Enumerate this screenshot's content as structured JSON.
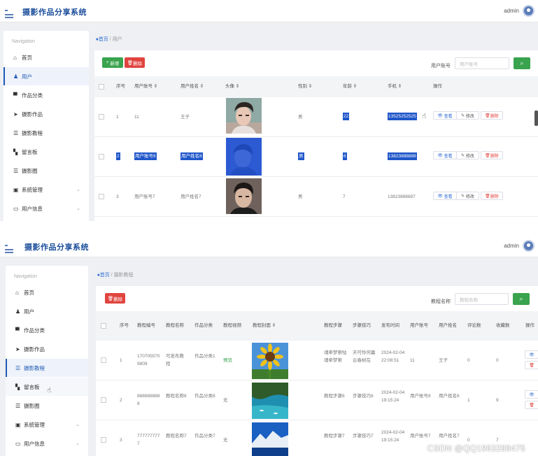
{
  "app": {
    "title": "摄影作品分享系统",
    "user": "admin"
  },
  "sidebar": {
    "title": "Navigation",
    "items": [
      {
        "label": "首页",
        "icon": "home-icon"
      },
      {
        "label": "用户",
        "icon": "user-icon"
      },
      {
        "label": "作品分类",
        "icon": "monitor-icon"
      },
      {
        "label": "摄影作品",
        "icon": "send-icon"
      },
      {
        "label": "摄影教程",
        "icon": "list-icon"
      },
      {
        "label": "留言板",
        "icon": "grid-icon"
      },
      {
        "label": "摄影圈",
        "icon": "list-icon"
      },
      {
        "label": "系统管理",
        "icon": "film-icon"
      },
      {
        "label": "用户信息",
        "icon": "card-icon"
      }
    ]
  },
  "users_page": {
    "breadcrumb": {
      "home": "首页",
      "current": "用户"
    },
    "add_label": "新增",
    "delete_label": "删除",
    "search_label": "用户账号",
    "search_placeholder": "用户账号",
    "columns": [
      "序号",
      "用户账号",
      "用户姓名",
      "头像",
      "性别",
      "年龄",
      "手机",
      "操作"
    ],
    "rows": [
      {
        "index": "1",
        "account": "11",
        "name": "王子",
        "gender": "男",
        "age": "22",
        "phone": "13525252525"
      },
      {
        "index": "2",
        "account": "用户账号8",
        "name": "用户姓名8",
        "gender": "男",
        "age": "8",
        "phone": "13823888888"
      },
      {
        "index": "3",
        "account": "用户账号7",
        "name": "用户姓名7",
        "gender": "男",
        "age": "7",
        "phone": "13823888887"
      }
    ],
    "actions": {
      "view": "查看",
      "edit": "修改",
      "delete": "删除"
    }
  },
  "tutorials_page": {
    "breadcrumb": {
      "home": "首页",
      "current": "摄影教程"
    },
    "delete_label": "删除",
    "search_label": "教程名称",
    "search_placeholder": "教程名称",
    "columns": [
      "序号",
      "教程编号",
      "教程名称",
      "作品分类",
      "教程视频",
      "教程封面",
      "教程步骤",
      "步骤技巧",
      "发布时间",
      "用户账号",
      "用户姓名",
      "评论数",
      "收藏数",
      "操作"
    ],
    "rows": [
      {
        "index": "1",
        "code": "1707055709809",
        "title": "可发布教程",
        "category": "作品分类1",
        "video": "预览",
        "steps": "魂牵梦萦牯魂牵梦萦",
        "tips": "天可怜何暮云春树在",
        "time": "2024-02-04 22:08:51",
        "account": "11",
        "username": "王子",
        "comments": "0",
        "favorites": "0"
      },
      {
        "index": "2",
        "code": "8888888888",
        "title": "教程名称8",
        "category": "作品分类8",
        "video": "无",
        "steps": "教程步骤8",
        "tips": "步骤技巧8",
        "time": "2024-02-04 19:15:24",
        "account": "用户账号8",
        "username": "用户姓名8",
        "comments": "1",
        "favorites": "9"
      },
      {
        "index": "3",
        "code": "7777777777",
        "title": "教程名称7",
        "category": "作品分类7",
        "video": "无",
        "steps": "教程步骤7",
        "tips": "步骤技巧7",
        "time": "2024-02-04 19:15:24",
        "account": "用户账号7",
        "username": "用户姓名7",
        "comments": "0",
        "favorites": "7"
      }
    ]
  },
  "watermark": "CSDN @QQ1963288475"
}
